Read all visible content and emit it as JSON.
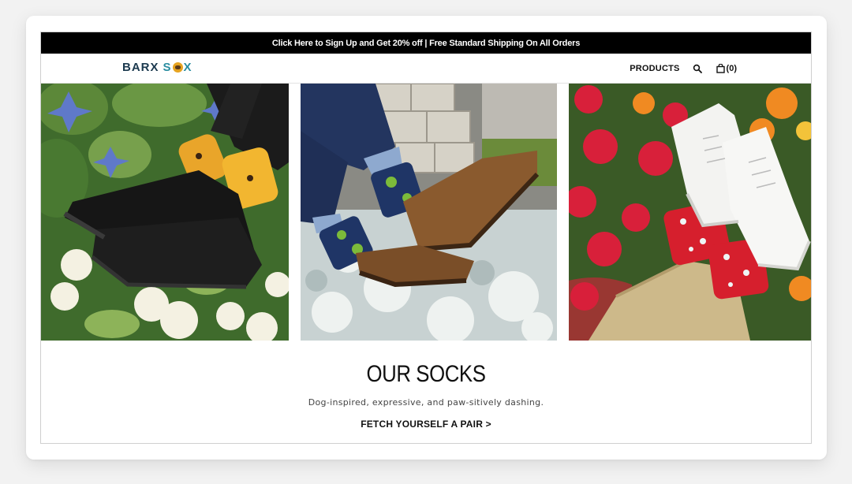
{
  "promo_banner": {
    "text": "Click Here to Sign Up and Get 20% off | Free Standard Shipping On All Orders"
  },
  "header": {
    "logo_text": {
      "part1": "BARX",
      "part2": "S",
      "part3": "X"
    },
    "nav": {
      "products_label": "PRODUCTS",
      "search_icon": "search-icon",
      "cart_icon": "shopping-bag-icon",
      "cart_count": "(0)"
    }
  },
  "hero_images": [
    {
      "label": "black sneakers with yellow dog socks on flowers"
    },
    {
      "label": "brown shoes with navy dog socks on dusty miller"
    },
    {
      "label": "white sneakers with red dog socks on flowers"
    }
  ],
  "section": {
    "title": "OUR SOCKS",
    "subtitle": "Dog-inspired, expressive, and paw-sitively dashing.",
    "cta_label": "FETCH YOURSELF A PAIR >"
  },
  "colors": {
    "promo_bg": "#000000",
    "logo_dark": "#1c3a4f",
    "logo_accent": "#2a8da0",
    "logo_dog": "#e6a320"
  }
}
